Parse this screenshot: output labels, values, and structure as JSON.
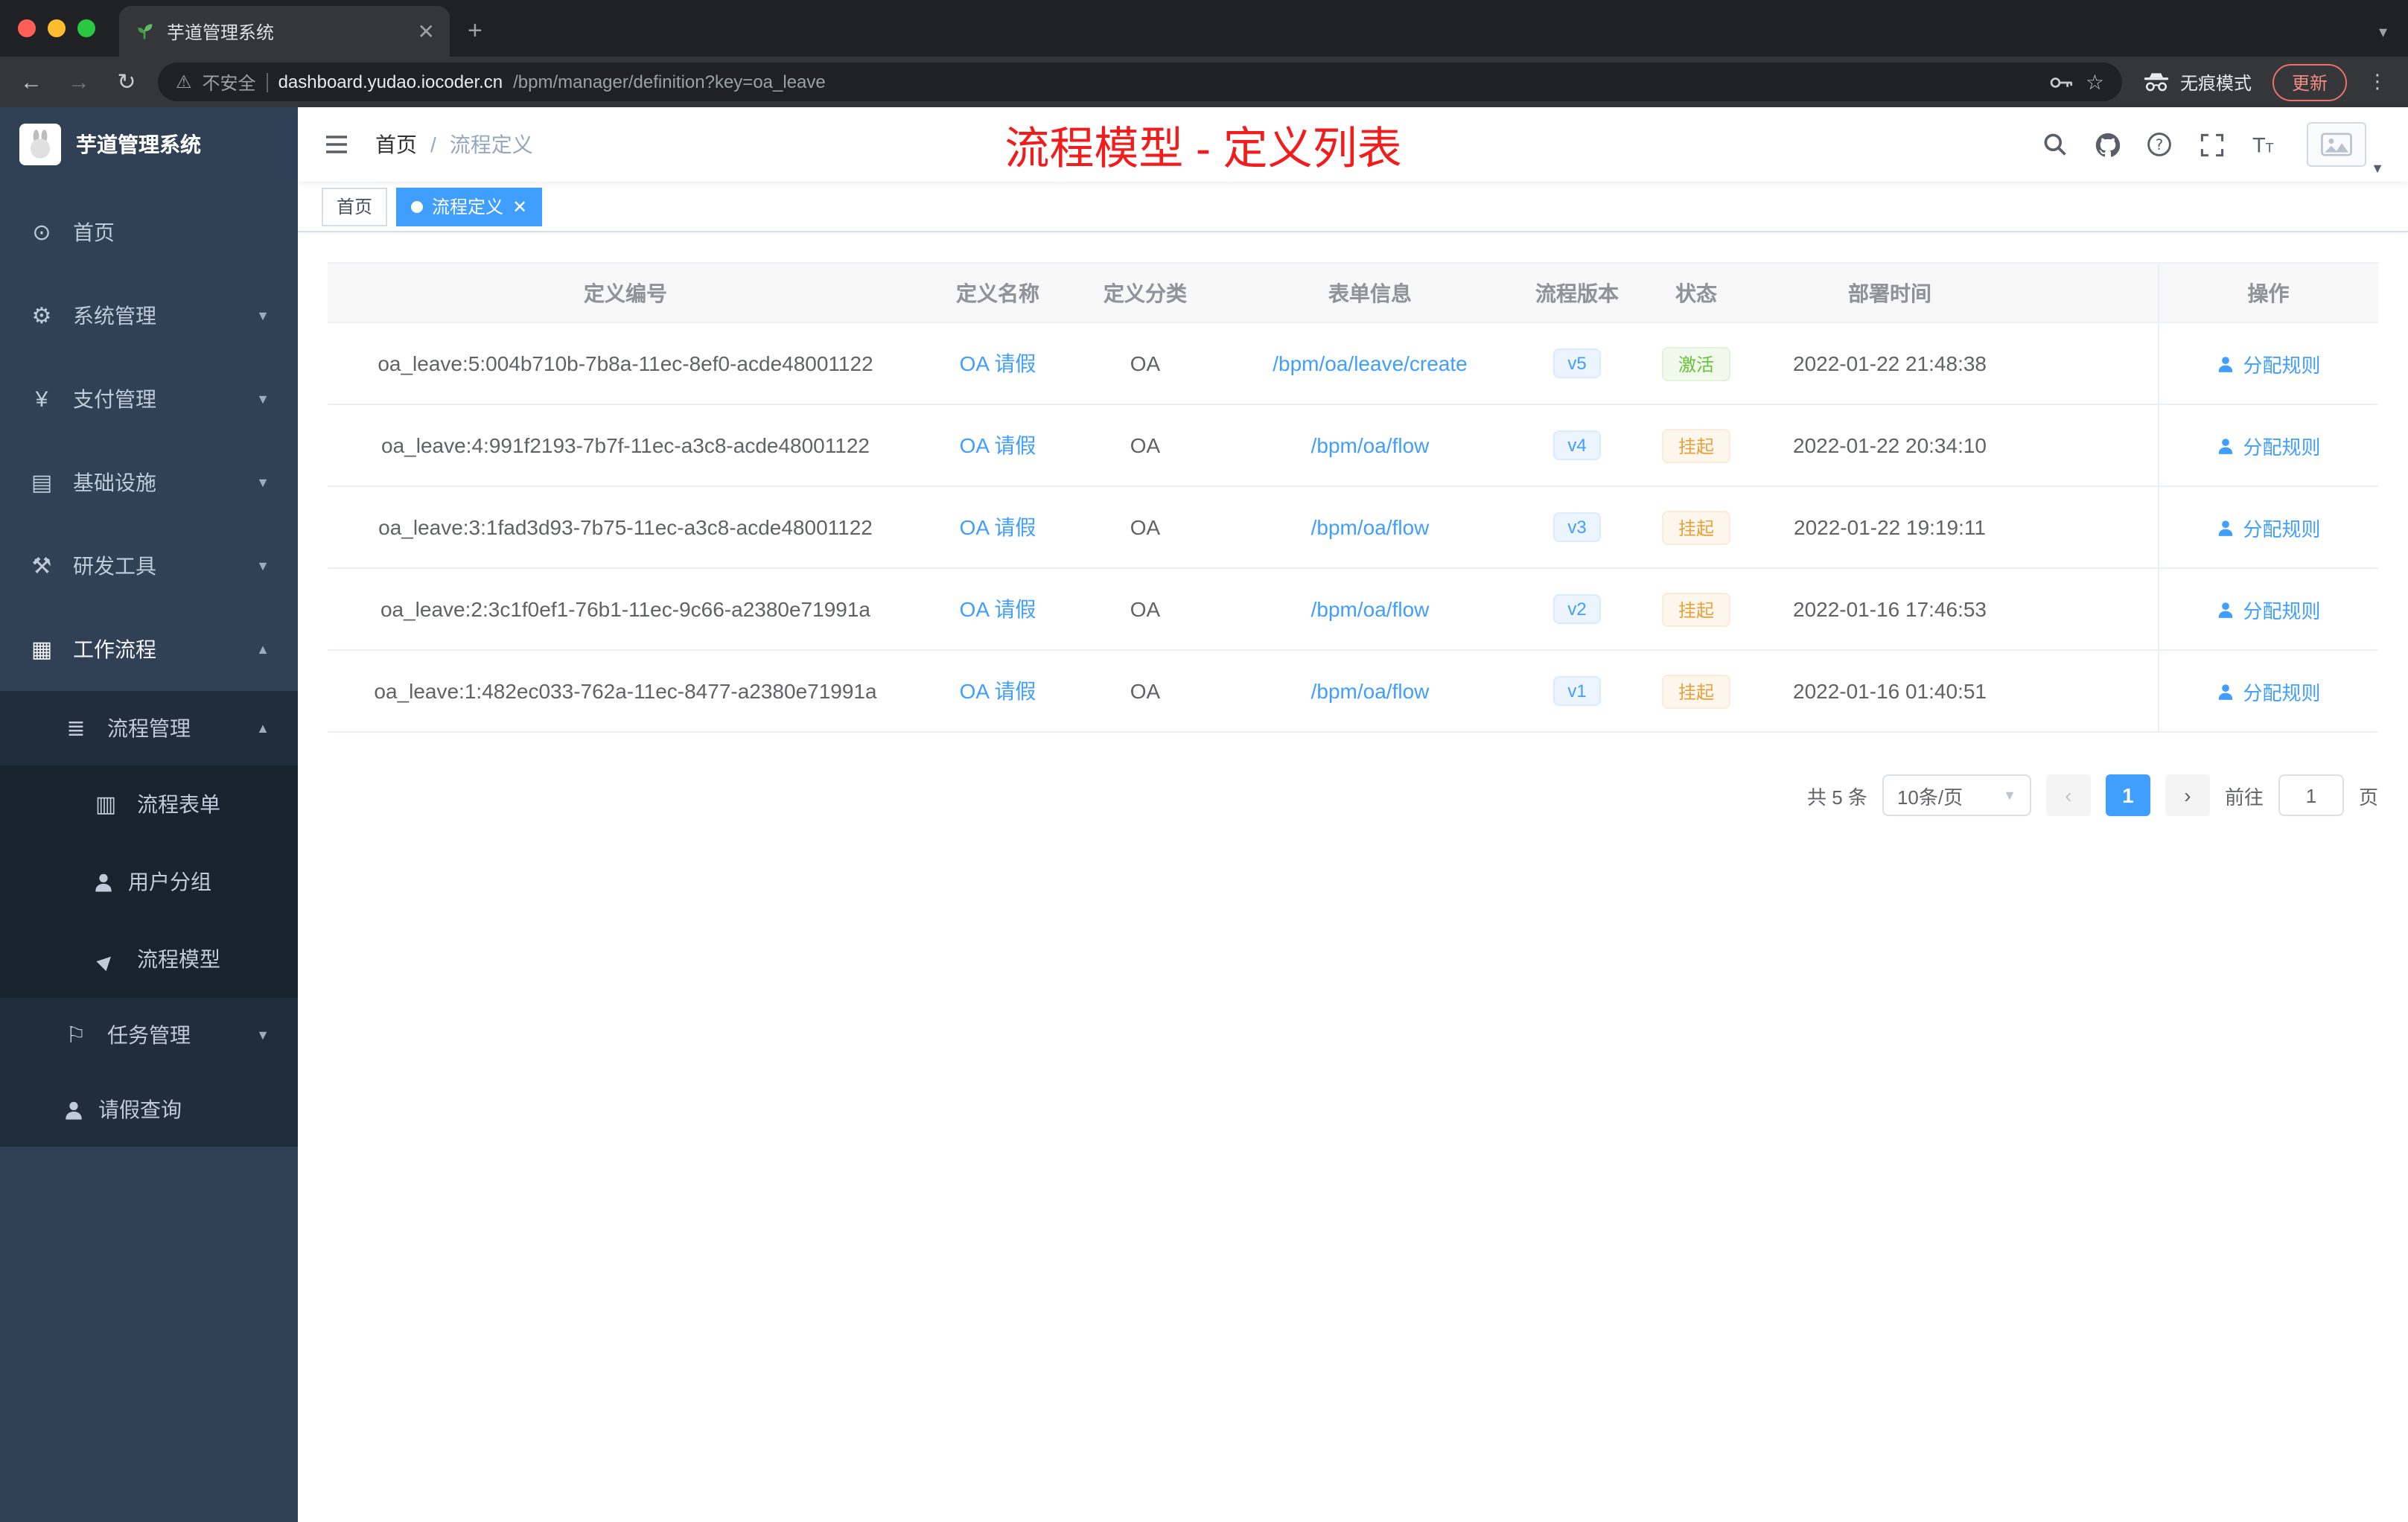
{
  "browser": {
    "tab_title": "芋道管理系统",
    "security_label": "不安全",
    "url_host": "dashboard.yudao.iocoder.cn",
    "url_path": "/bpm/manager/definition?key=oa_leave",
    "incognito_label": "无痕模式",
    "update_label": "更新"
  },
  "sidebar": {
    "logo_title": "芋道管理系统",
    "menu": [
      {
        "label": "首页",
        "glyph": "⊙"
      },
      {
        "label": "系统管理",
        "glyph": "⚙"
      },
      {
        "label": "支付管理",
        "glyph": "¥"
      },
      {
        "label": "基础设施",
        "glyph": "▤"
      },
      {
        "label": "研发工具",
        "glyph": "⚒"
      },
      {
        "label": "工作流程",
        "glyph": "▦"
      },
      {
        "label": "流程管理",
        "glyph": "≣"
      },
      {
        "label": "流程表单",
        "glyph": "▥"
      },
      {
        "label": "用户分组"
      },
      {
        "label": "流程模型",
        "glyph": "▶"
      },
      {
        "label": "任务管理",
        "glyph": "⚐"
      },
      {
        "label": "请假查询"
      }
    ]
  },
  "header": {
    "breadcrumb": {
      "home": "首页",
      "separator": "/",
      "current": "流程定义"
    },
    "annotation": "流程模型 - 定义列表"
  },
  "tags": {
    "home": "首页",
    "active": "流程定义"
  },
  "table": {
    "columns": [
      "定义编号",
      "定义名称",
      "定义分类",
      "表单信息",
      "流程版本",
      "状态",
      "部署时间",
      "操作"
    ],
    "rows": [
      {
        "id": "oa_leave:5:004b710b-7b8a-11ec-8ef0-acde48001122",
        "name": "OA 请假",
        "category": "OA",
        "form": "/bpm/oa/leave/create",
        "version": "v5",
        "status": "激活",
        "status_type": "success",
        "deployed": "2022-01-22 21:48:38",
        "action": "分配规则"
      },
      {
        "id": "oa_leave:4:991f2193-7b7f-11ec-a3c8-acde48001122",
        "name": "OA 请假",
        "category": "OA",
        "form": "/bpm/oa/flow",
        "version": "v4",
        "status": "挂起",
        "status_type": "warning",
        "deployed": "2022-01-22 20:34:10",
        "action": "分配规则"
      },
      {
        "id": "oa_leave:3:1fad3d93-7b75-11ec-a3c8-acde48001122",
        "name": "OA 请假",
        "category": "OA",
        "form": "/bpm/oa/flow",
        "version": "v3",
        "status": "挂起",
        "status_type": "warning",
        "deployed": "2022-01-22 19:19:11",
        "action": "分配规则"
      },
      {
        "id": "oa_leave:2:3c1f0ef1-76b1-11ec-9c66-a2380e71991a",
        "name": "OA 请假",
        "category": "OA",
        "form": "/bpm/oa/flow",
        "version": "v2",
        "status": "挂起",
        "status_type": "warning",
        "deployed": "2022-01-16 17:46:53",
        "action": "分配规则"
      },
      {
        "id": "oa_leave:1:482ec033-762a-11ec-8477-a2380e71991a",
        "name": "OA 请假",
        "category": "OA",
        "form": "/bpm/oa/flow",
        "version": "v1",
        "status": "挂起",
        "status_type": "warning",
        "deployed": "2022-01-16 01:40:51",
        "action": "分配规则"
      }
    ]
  },
  "pagination": {
    "total": "共 5 条",
    "page_size": "10条/页",
    "current_page": "1",
    "goto_label": "前往",
    "goto_value": "1",
    "page_unit": "页"
  },
  "colors": {
    "accent": "#409eff",
    "success": "#67c23a",
    "warning": "#e6a23c",
    "annotation_red": "#f11c1c",
    "sidebar_bg": "#304156"
  }
}
